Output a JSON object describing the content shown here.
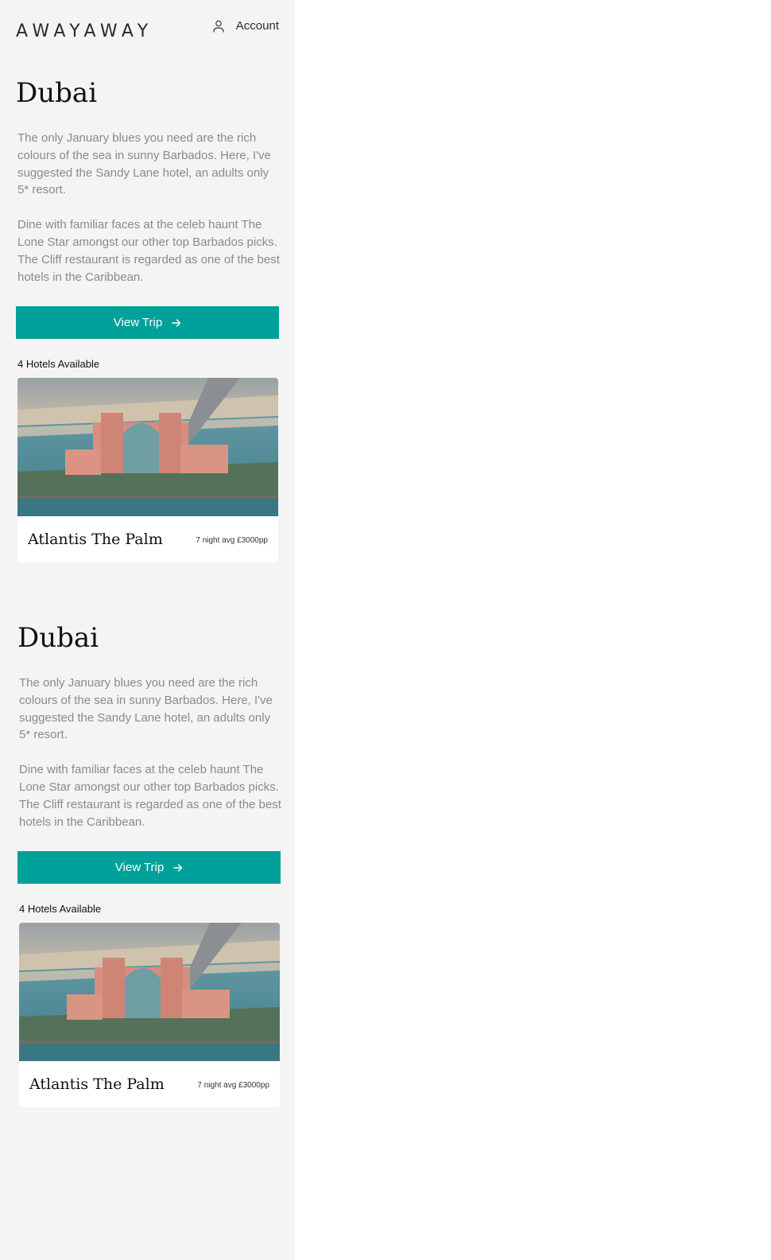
{
  "header": {
    "logo": "AWAYAWAY",
    "account_label": "Account",
    "account_icon": "user-icon"
  },
  "trips": [
    {
      "destination": "Dubai",
      "paragraphs": [
        "The only January blues you need are the rich colours of the sea in sunny Barbados. Here, I've suggested the Sandy Lane hotel, an adults only 5* resort.",
        "Dine with familiar faces at the celeb haunt The Lone Star amongst our other top Barbados picks. The Cliff restaurant is regarded as one of the best hotels in the Caribbean."
      ],
      "button_label": "View Trip",
      "button_icon": "arrow-right-icon",
      "hotels_available": "4 Hotels Available",
      "hotel": {
        "name": "Atlantis The Palm",
        "price": "7 night avg £3000pp",
        "image": "hotel-photo"
      }
    },
    {
      "destination": "Dubai",
      "paragraphs": [
        "The only January blues you need are the rich colours of the sea in sunny Barbados. Here, I've suggested the Sandy Lane hotel, an adults only 5* resort.",
        "Dine with familiar faces at the celeb haunt The Lone Star amongst our other top Barbados picks. The Cliff restaurant is regarded as one of the best hotels in the Caribbean."
      ],
      "button_label": "View Trip",
      "button_icon": "arrow-right-icon",
      "hotels_available": "4 Hotels Available",
      "hotel": {
        "name": "Atlantis The Palm",
        "price": "7 night avg £3000pp",
        "image": "hotel-photo"
      }
    }
  ],
  "colors": {
    "accent": "#00a19a",
    "panel_background": "#f4f4f4",
    "body_text": "#8a8a8a"
  }
}
